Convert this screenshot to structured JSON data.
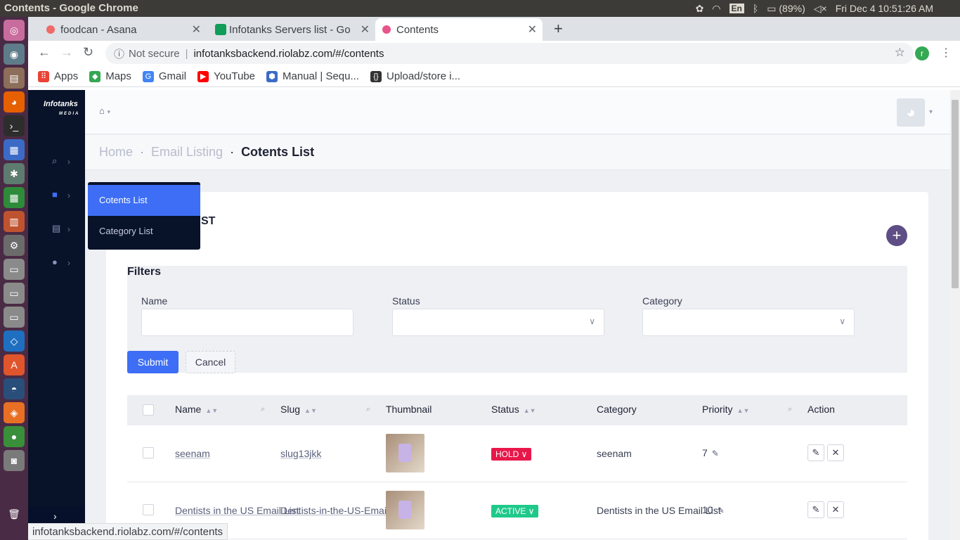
{
  "os": {
    "window_title": "Contents - Google Chrome",
    "lang": "En",
    "battery": "(89%)",
    "clock": "Fri Dec  4 10:51:26 AM"
  },
  "tabs": [
    {
      "title": "foodcan - Asana",
      "color": "#f06a6a"
    },
    {
      "title": "Infotanks Servers list - Go",
      "color": "#0f9d58"
    },
    {
      "title": "Contents",
      "color": "#e8548c"
    }
  ],
  "address": {
    "not_secure": "Not secure",
    "url": "infotanksbackend.riolabz.com/#/contents",
    "profile_initial": "r"
  },
  "bookmarks": [
    {
      "label": "Apps",
      "icon": "apps-grid-icon",
      "color": "#ea4335"
    },
    {
      "label": "Maps",
      "icon": "maps-icon",
      "color": "#34a853"
    },
    {
      "label": "Gmail",
      "icon": "google-icon",
      "color": "#4285f4"
    },
    {
      "label": "YouTube",
      "icon": "youtube-icon",
      "color": "#ff0000"
    },
    {
      "label": "Manual | Sequ...",
      "icon": "sequelize-icon",
      "color": "#3b6bc7"
    },
    {
      "label": "Upload/store i...",
      "icon": "code-icon",
      "color": "#333333"
    }
  ],
  "app": {
    "logo": "Infotanks",
    "logo_sub": "MEDIA",
    "submenu": [
      "Cotents List",
      "Category List"
    ],
    "breadcrumb": {
      "home": "Home",
      "mid": "Email Listing",
      "current": "Cotents List"
    },
    "card_title": "ST",
    "filters": {
      "title": "Filters",
      "name_label": "Name",
      "status_label": "Status",
      "category_label": "Category",
      "submit": "Submit",
      "cancel": "Cancel"
    },
    "table": {
      "headers": [
        "Name",
        "Slug",
        "Thumbnail",
        "Status",
        "Category",
        "Priority",
        "Action"
      ],
      "rows": [
        {
          "name": "seenam",
          "slug": "slug13jkk",
          "status": "HOLD",
          "status_color": "#e8174a",
          "category": "seenam",
          "priority": "7"
        },
        {
          "name": "Dentists in the US Email List",
          "slug": "Dentists-in-the-US-Email",
          "status": "ACTIVE",
          "status_color": "#1fc98a",
          "category": "Dentists in the US Email List",
          "priority": "10"
        }
      ]
    }
  },
  "status_bar": "infotanksbackend.riolabz.com/#/contents"
}
